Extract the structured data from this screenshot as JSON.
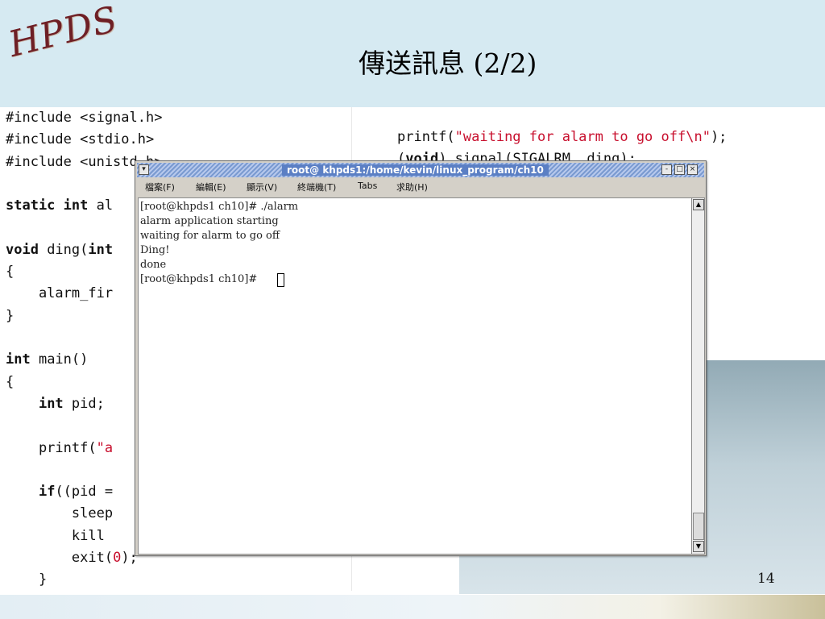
{
  "header": {
    "logo": "HPDS",
    "title": "傳送訊息 (2/2)"
  },
  "code_left": {
    "lines": [
      [
        {
          "t": "#include <signal.h>"
        }
      ],
      [
        {
          "t": "#include <stdio.h>"
        }
      ],
      [
        {
          "t": "#include <unistd.h>"
        }
      ],
      [
        {
          "t": ""
        }
      ],
      [
        {
          "t": "static int",
          "kw": true
        },
        {
          "t": " al"
        }
      ],
      [
        {
          "t": ""
        }
      ],
      [
        {
          "t": "void",
          "kw": true
        },
        {
          "t": " ding("
        },
        {
          "t": "int",
          "kw": true
        }
      ],
      [
        {
          "t": "{"
        }
      ],
      [
        {
          "t": "    alarm_fir"
        }
      ],
      [
        {
          "t": "}"
        }
      ],
      [
        {
          "t": ""
        }
      ],
      [
        {
          "t": "int",
          "kw": true
        },
        {
          "t": " main()"
        }
      ],
      [
        {
          "t": "{"
        }
      ],
      [
        {
          "t": "    "
        },
        {
          "t": "int",
          "kw": true
        },
        {
          "t": " pid;"
        }
      ],
      [
        {
          "t": ""
        }
      ],
      [
        {
          "t": "    printf("
        },
        {
          "t": "\"a",
          "str": true
        }
      ],
      [
        {
          "t": ""
        }
      ],
      [
        {
          "t": "    "
        },
        {
          "t": "if",
          "kw": true
        },
        {
          "t": "((pid ="
        }
      ],
      [
        {
          "t": "        sleep"
        }
      ],
      [
        {
          "t": "        kill"
        }
      ],
      [
        {
          "t": "        exit("
        },
        {
          "t": "0",
          "str": true
        },
        {
          "t": ");"
        }
      ],
      [
        {
          "t": "    }"
        }
      ]
    ]
  },
  "code_right": {
    "lines": [
      [
        {
          "t": "printf("
        },
        {
          "t": "\"waiting for alarm to go off\\n\"",
          "str": true
        },
        {
          "t": ");"
        }
      ],
      [
        {
          "t": "("
        },
        {
          "t": "void",
          "kw": true
        },
        {
          "t": ") signal(SIGALRM, ding);"
        }
      ]
    ]
  },
  "terminal": {
    "title": "root@ khpds1:/home/kevin/linux_program/ch10",
    "menu": [
      "檔案(F)",
      "編輯(E)",
      "顯示(V)",
      "終端機(T)",
      "Tabs",
      "求助(H)"
    ],
    "lines": [
      "[root@khpds1 ch10]# ./alarm",
      "alarm application starting",
      "waiting for alarm to go off",
      "Ding!",
      "done",
      "[root@khpds1 ch10]# "
    ],
    "buttons": {
      "minimize": "-",
      "maximize": "□",
      "close": "×"
    },
    "scroll": {
      "up": "▲",
      "down": "▼"
    }
  },
  "footer": {
    "page": "14"
  }
}
